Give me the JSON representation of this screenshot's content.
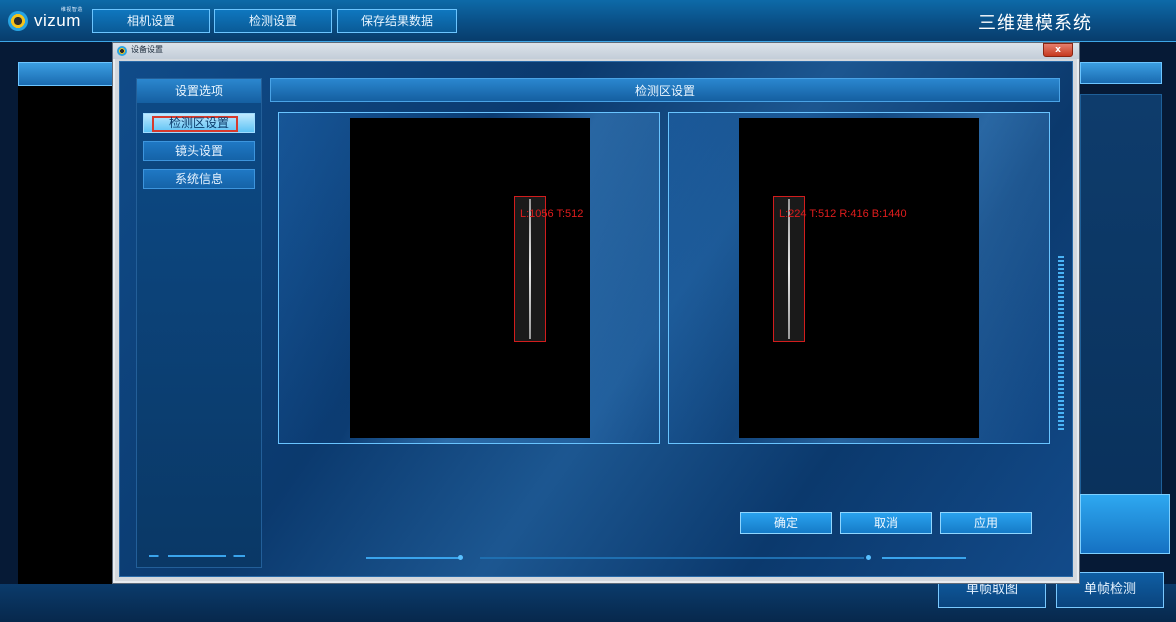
{
  "header": {
    "logo_text": "vizum",
    "logo_sub": "维视智造",
    "nav": [
      "相机设置",
      "检测设置",
      "保存结果数据"
    ],
    "app_title": "三维建模系统"
  },
  "bottom_buttons": [
    "单帧取图",
    "单帧检测"
  ],
  "dialog": {
    "title": "设备设置",
    "close_label": "x",
    "left_header": "设置选项",
    "left_items": [
      "检测区设置",
      "镜头设置",
      "系统信息"
    ],
    "main_header": "检测区设置",
    "cameras": [
      {
        "roi_label": "L:1056 T:512"
      },
      {
        "roi_label": "L:224 T:512 R:416 B:1440"
      }
    ],
    "buttons": {
      "ok": "确定",
      "cancel": "取消",
      "apply": "应用"
    }
  },
  "colors": {
    "accent": "#2aa2ee",
    "roi": "#d11d1d",
    "background": "#0b3a6e"
  }
}
